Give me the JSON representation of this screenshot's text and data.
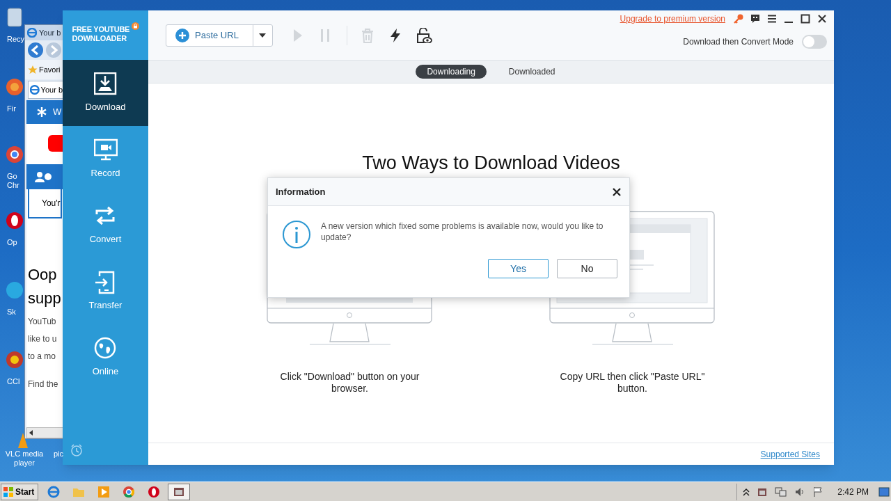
{
  "desktop_icons": [
    {
      "label": "Recy"
    },
    {
      "label": "Fir"
    },
    {
      "label": "Go Chr"
    },
    {
      "label": "Op"
    },
    {
      "label": "Sk"
    },
    {
      "label": "CCl"
    },
    {
      "label": "VLC media player"
    },
    {
      "label": "pic"
    }
  ],
  "browser_window": {
    "title": "Your b",
    "favorites": "Favori",
    "tab": "Your b",
    "header": "W",
    "notice": "You'r",
    "heading_lines": [
      "Oop",
      "supp"
    ],
    "body_lines": [
      "YouTub",
      "like to u",
      "to a mo"
    ],
    "footer": "Find the"
  },
  "app": {
    "logo": "FREE YOUTUBE DOWNLOADER",
    "nav": [
      {
        "label": "Download",
        "kind": "download",
        "selected": true
      },
      {
        "label": "Record",
        "kind": "record",
        "selected": false
      },
      {
        "label": "Convert",
        "kind": "convert",
        "selected": false
      },
      {
        "label": "Transfer",
        "kind": "transfer",
        "selected": false
      },
      {
        "label": "Online",
        "kind": "online",
        "selected": false
      }
    ],
    "paste_url": "Paste URL",
    "tools": [
      {
        "kind": "play",
        "disabled": true
      },
      {
        "kind": "pause",
        "disabled": true
      },
      {
        "kind": "delete",
        "disabled": true
      },
      {
        "kind": "boost",
        "disabled": false
      },
      {
        "kind": "private",
        "disabled": false
      }
    ],
    "upgrade_link": "Upgrade to premium version",
    "mode": {
      "label": "Download then Convert Mode",
      "on": false
    },
    "tabs": [
      {
        "label": "Downloading",
        "selected": true
      },
      {
        "label": "Downloaded",
        "selected": false
      }
    ],
    "heading": "Two Ways to Download Videos",
    "methods": [
      {
        "caption": "Click \"Download\" button on your browser."
      },
      {
        "caption": "Copy URL then click \"Paste URL\" button."
      }
    ],
    "supported_sites": "Supported Sites"
  },
  "dialog": {
    "title": "Information",
    "message": "A new version which fixed some problems is available now, would you like to update?",
    "buttons": [
      {
        "label": "Yes",
        "selected": true
      },
      {
        "label": "No",
        "selected": false
      }
    ]
  },
  "taskbar": {
    "start": "Start",
    "apps": [
      {
        "kind": "browser",
        "selected": false
      },
      {
        "kind": "folder",
        "selected": false
      },
      {
        "kind": "media",
        "selected": false
      },
      {
        "kind": "chrome",
        "selected": false
      },
      {
        "kind": "opera",
        "selected": false
      },
      {
        "kind": "downloader",
        "selected": true
      }
    ],
    "clock": "2:42 PM"
  }
}
